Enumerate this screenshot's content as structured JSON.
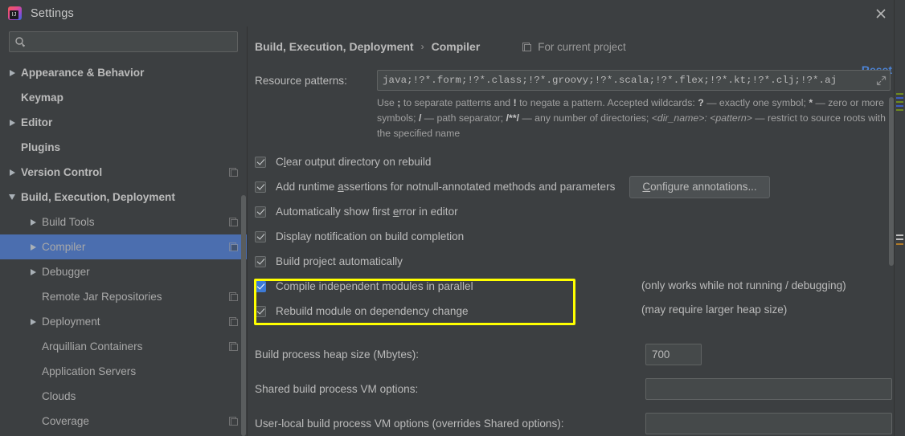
{
  "window": {
    "title": "Settings",
    "app_icon": "intellij-idea-icon",
    "close_icon": "close-icon"
  },
  "sidebar": {
    "search": {
      "placeholder": "",
      "value": "",
      "icon": "search-icon"
    },
    "items": [
      {
        "label": "Appearance & Behavior",
        "level": 0,
        "arrow": "right",
        "badge": false
      },
      {
        "label": "Keymap",
        "level": 0,
        "arrow": "none",
        "badge": false
      },
      {
        "label": "Editor",
        "level": 0,
        "arrow": "right",
        "badge": false
      },
      {
        "label": "Plugins",
        "level": 0,
        "arrow": "none",
        "badge": false
      },
      {
        "label": "Version Control",
        "level": 0,
        "arrow": "right",
        "badge": true
      },
      {
        "label": "Build, Execution, Deployment",
        "level": 0,
        "arrow": "down",
        "badge": false
      },
      {
        "label": "Build Tools",
        "level": 1,
        "arrow": "right",
        "badge": true
      },
      {
        "label": "Compiler",
        "level": 1,
        "arrow": "right",
        "badge": true,
        "selected": true
      },
      {
        "label": "Debugger",
        "level": 1,
        "arrow": "right",
        "badge": false
      },
      {
        "label": "Remote Jar Repositories",
        "level": 1,
        "arrow": "none",
        "badge": true
      },
      {
        "label": "Deployment",
        "level": 1,
        "arrow": "right",
        "badge": true
      },
      {
        "label": "Arquillian Containers",
        "level": 1,
        "arrow": "none",
        "badge": true
      },
      {
        "label": "Application Servers",
        "level": 1,
        "arrow": "none",
        "badge": false
      },
      {
        "label": "Clouds",
        "level": 1,
        "arrow": "none",
        "badge": false
      },
      {
        "label": "Coverage",
        "level": 1,
        "arrow": "none",
        "badge": true
      }
    ]
  },
  "header": {
    "breadcrumb_parent": "Build, Execution, Deployment",
    "breadcrumb_separator": "›",
    "breadcrumb_current": "Compiler",
    "for_current_project": "For current project",
    "for_current_project_icon": "project-scope-icon",
    "reset_label": "Reset"
  },
  "resource_patterns": {
    "label": "Resource patterns:",
    "value": "java;!?*.form;!?*.class;!?*.groovy;!?*.scala;!?*.flex;!?*.kt;!?*.clj;!?*.aj",
    "expand_icon": "expand-field-icon",
    "hint_line1_a": "Use ",
    "hint_semicolon": ";",
    "hint_line1_b": " to separate patterns and ",
    "hint_bang": "!",
    "hint_line1_c": " to negate a pattern. Accepted wildcards: ",
    "hint_q": "?",
    "hint_line1_d": " — exactly one symbol; ",
    "hint_star": "*",
    "hint_line2_a": " — zero or more symbols; ",
    "hint_slash": "/",
    "hint_line2_b": " — path separator; ",
    "hint_globstar": "/**/",
    "hint_line2_c": " — any number of directories; ",
    "hint_dirname": "<dir_name>:",
    "hint_pattern": "<pattern>",
    "hint_line3": " — restrict to source roots with the specified name"
  },
  "checkboxes": [
    {
      "label": "Clear output directory on rebuild",
      "checked": true,
      "focused": false,
      "mnemonic": "l"
    },
    {
      "label": "Add runtime assertions for notnull-annotated methods and parameters",
      "checked": true,
      "focused": false,
      "mnemonic": "a"
    },
    {
      "label": "Automatically show first error in editor",
      "checked": true,
      "focused": false,
      "mnemonic": "e"
    },
    {
      "label": "Display notification on build completion",
      "checked": true,
      "focused": false,
      "mnemonic": ""
    },
    {
      "label": "Build project automatically",
      "checked": true,
      "focused": false,
      "mnemonic": ""
    },
    {
      "label": "Compile independent modules in parallel",
      "checked": true,
      "focused": true,
      "mnemonic": ""
    },
    {
      "label": "Rebuild module on dependency change",
      "checked": true,
      "focused": false,
      "mnemonic": ""
    }
  ],
  "configure_annotations_button": "Configure annotations...",
  "side_notes": [
    "(only works while not running / debugging)",
    "(may require larger heap size)"
  ],
  "fields": [
    {
      "label": "Build process heap size (Mbytes):",
      "value": "700",
      "placeholder": ""
    },
    {
      "label": "Shared build process VM options:",
      "value": "",
      "placeholder": ""
    },
    {
      "label": "User-local build process VM options (overrides Shared options):",
      "value": "",
      "placeholder": ""
    }
  ],
  "colors": {
    "background": "#3c3f41",
    "selection_blue": "#4b6eaf",
    "highlight_yellow": "#ffff00",
    "link_blue": "#4d84d6",
    "checkbox_focus_blue": "#3d7ad6",
    "text": "#bbbbbb"
  }
}
